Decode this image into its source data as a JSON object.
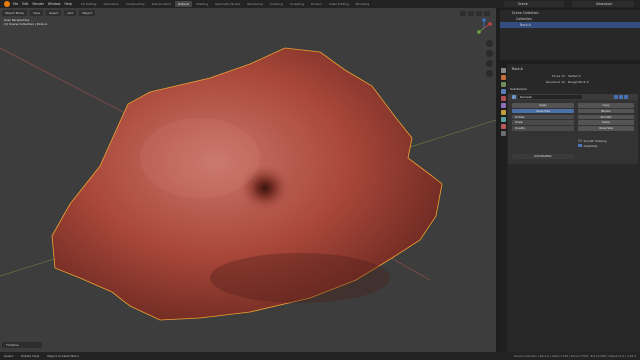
{
  "topbar": {
    "menu": [
      "File",
      "Edit",
      "Render",
      "Window",
      "Help"
    ],
    "tabs": [
      "UV Editing",
      "Animation",
      "Compositing",
      "Texture Paint",
      "Default",
      "Shading",
      "Geometry Nodes",
      "Rendering",
      "Scripting",
      "Sculpting",
      "Drivers",
      "Video Editing",
      "Modeling"
    ],
    "active_tab": "Default",
    "scene": "Scene",
    "view_layer": "ViewLayer"
  },
  "viewport": {
    "header_items": [
      "Object Mode",
      "View",
      "Select",
      "Add",
      "Object"
    ],
    "info_line1": "User Perspective",
    "info_line2": "(1) Scene Collection | Rock.A",
    "bottom_tab": "Timeline",
    "colors": {
      "background": "#3d3d3d",
      "mesh": "#b5584a",
      "outline": "#f0a030",
      "x_axis": "#a05050",
      "y_axis": "#8aa040"
    }
  },
  "outliner": {
    "rows": [
      {
        "label": "Scene Collection",
        "selected": false,
        "level": 0
      },
      {
        "label": "Collection",
        "selected": false,
        "level": 1
      },
      {
        "label": "Rock.A",
        "selected": true,
        "level": 2
      }
    ]
  },
  "properties": {
    "header": "Rock.A",
    "dims": [
      {
        "k": "Faces 15",
        "v": "Vertex 0"
      },
      {
        "k": "Rendered 40",
        "v": "Rough Rock 0"
      }
    ],
    "subdivision_title": "Subdivision",
    "modifier_name": "Remesh",
    "left_buttons": [
      {
        "label": "Apply",
        "style": "normal"
      },
      {
        "label": "Voxel Size",
        "style": "active"
      },
      {
        "label": "Octree",
        "style": "field"
      },
      {
        "label": "Scale",
        "style": "field"
      },
      {
        "label": "Quality",
        "style": "field"
      }
    ],
    "right_buttons": [
      "Copy",
      "Blocks",
      "Smooth",
      "Sharp",
      "Voxel Size"
    ],
    "checks": [
      {
        "label": "Smooth Shading",
        "on": false
      },
      {
        "label": "Adaptivity",
        "on": true
      }
    ],
    "add_button": "Add Modifier",
    "tab_colors": [
      "#8a8a8a",
      "#c26d3a",
      "#6f8c5a",
      "#5a7fb8",
      "#b05050",
      "#8e6fb8",
      "#c2a040",
      "#5aa0a0",
      "#b85a5a",
      "#6e6e6e"
    ]
  },
  "statusbar": {
    "items": [
      "Select",
      "Rotate View",
      "Object Context Menu"
    ],
    "stats": "Scene Collection | Rock.A | Verts:7,534 | Faces:7,504 | Tris:15,008 | Objects:1/1 | 2.93.0"
  }
}
